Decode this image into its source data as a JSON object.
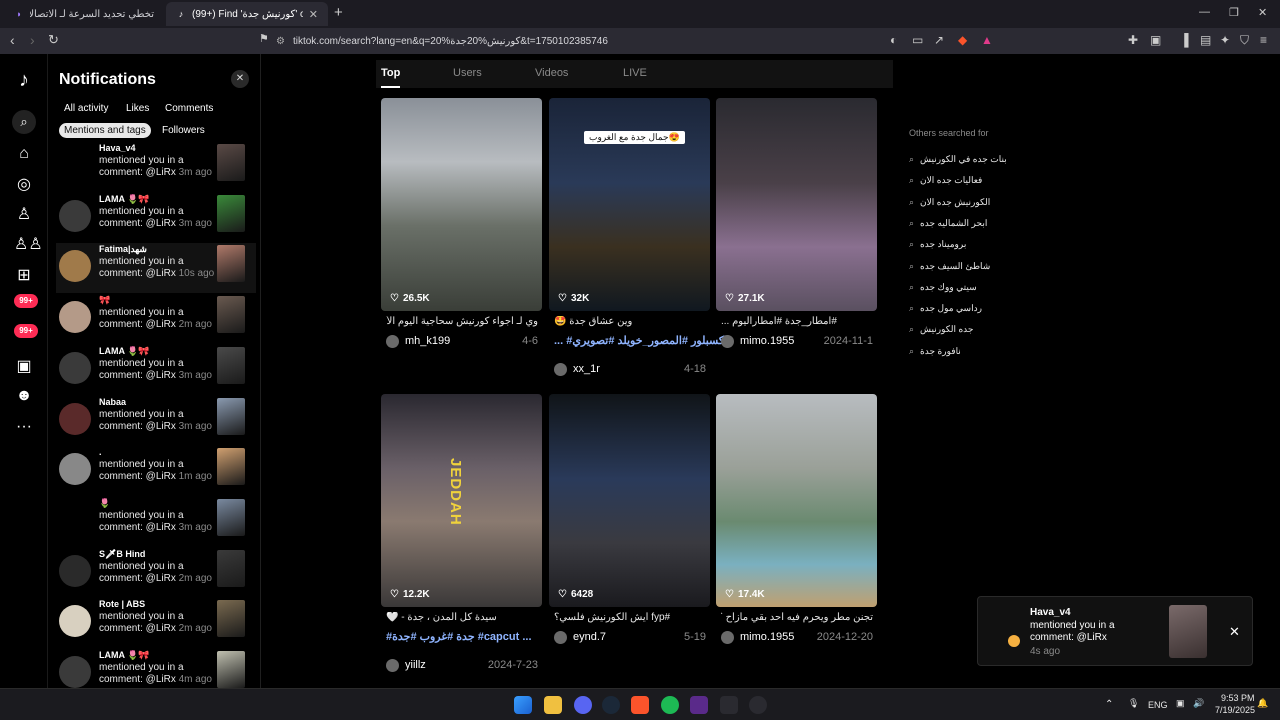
{
  "browser": {
    "tabs": [
      {
        "title": "تخطي تحديد السرعة لـ الاتصالات السعو",
        "active": false
      },
      {
        "title": "(99+) Find 'كورنيش جدة' on TikTok",
        "active": true
      }
    ],
    "new_tab": "+",
    "url": "tiktok.com/search?lang=en&q=كورنيش%20جدة%20&t=1750102385746",
    "window_controls": [
      "—",
      "❐",
      "✕"
    ]
  },
  "rail": {
    "badges": [
      "99+",
      "99+"
    ]
  },
  "notifications": {
    "title": "Notifications",
    "close": "✕",
    "filters": [
      "All activity",
      "Likes",
      "Comments",
      "Mentions and tags",
      "Followers"
    ],
    "active_filter": "Mentions and tags",
    "items": [
      {
        "name": "Hava_v4",
        "line1": "mentioned you in a",
        "line2": "comment: @LiRx",
        "ago": "3m ago",
        "thumb": "#5a4a46",
        "avatar": "none"
      },
      {
        "name": "LAMA 🌷🎀",
        "line1": "mentioned you in a",
        "line2": "comment: @LiRx",
        "ago": "3m ago",
        "thumb": "#3a8a3a",
        "avatar": "#3a3a3a"
      },
      {
        "name": "Fatima|شهد",
        "line1": "mentioned you in a",
        "line2": "comment: @LiRx",
        "ago": "10s ago",
        "thumb": "#b07a6a",
        "avatar": "#a07a4a"
      },
      {
        "name": "🎀",
        "line1": "mentioned you in a",
        "line2": "comment: @LiRx",
        "ago": "2m ago",
        "thumb": "#6a5a50",
        "avatar": "#b49a88"
      },
      {
        "name": "LAMA 🌷🎀",
        "line1": "mentioned you in a",
        "line2": "comment: @LiRx",
        "ago": "3m ago",
        "thumb": "#4a4a4a",
        "avatar": "#3a3a3a"
      },
      {
        "name": "Nabaa",
        "line1": "mentioned you in a",
        "line2": "comment: @LiRx",
        "ago": "3m ago",
        "thumb": "#8a9ab0",
        "avatar": "#5a2a2a"
      },
      {
        "name": ".",
        "line1": "mentioned you in a",
        "line2": "comment: @LiRx",
        "ago": "1m ago",
        "thumb": "#d0a070",
        "avatar": "#888888"
      },
      {
        "name": "🌷",
        "line1": "mentioned you in a",
        "line2": "comment: @LiRx",
        "ago": "3m ago",
        "thumb": "#7a8aa0",
        "avatar": "none"
      },
      {
        "name": "S🗡B Hind",
        "line1": "mentioned you in a",
        "line2": "comment: @LiRx",
        "ago": "2m ago",
        "thumb": "#3a3a3a",
        "avatar": "#2a2a2a"
      },
      {
        "name": "Rote | ABS",
        "line1": "mentioned you in a",
        "line2": "comment: @LiRx",
        "ago": "2m ago",
        "thumb": "#7a6a50",
        "avatar": "#d8d0c0"
      },
      {
        "name": "LAMA 🌷🎀",
        "line1": "mentioned you in a",
        "line2": "comment: @LiRx",
        "ago": "4m ago",
        "thumb": "#c0c0b0",
        "avatar": "#3a3a3a"
      }
    ]
  },
  "search_tabs": [
    "Top",
    "Users",
    "Videos",
    "LIVE"
  ],
  "active_search_tab": "Top",
  "videos": [
    {
      "likes": "26.5K",
      "desc": "وي لـ اجواء كورنيش سحاجية اليوم الأحد...",
      "tags": "",
      "user": "mh_k199",
      "date": "4-6",
      "bg": "linear-gradient(180deg,#8a9098 0%,#b8bcc0 30%,#6a7068 60%,#3a3e38 100%)",
      "label": ""
    },
    {
      "likes": "32K",
      "desc": "وين عشاق جدة 🤩",
      "tags": "... #اكسبلور #المصور_خويلد #تصويري",
      "user": "xx_1r",
      "date": "4-18",
      "bg": "linear-gradient(180deg,#1a2438 0%,#2a3a58 40%,#3a3020 70%,#101820 100%)",
      "label": "جمال جدة مع الغروب😍"
    },
    {
      "likes": "27.1K",
      "desc": "#امطار_جدة #امطاراليوم ...",
      "tags": "",
      "user": "mimo.1955",
      "date": "2024-11-1",
      "bg": "linear-gradient(180deg,#2a2a30 0%,#4a4048 40%,#8a7090 70%,#5a5060 100%)",
      "label": ""
    },
    {
      "likes": "12.2K",
      "desc": "سيدة كل المدن ، جدة - 🤍",
      "tags": "#جدة #غروب #جدة #capcut ...",
      "user": "yiillz",
      "date": "2024-7-23",
      "bg": "linear-gradient(180deg,#2a2830 0%,#6a6068 35%,#8a7a70 60%,#3a3838 100%)",
      "label": "JEDDAH"
    },
    {
      "likes": "6428",
      "desc": "#fyp ايش الكورنيش فلسي؟",
      "tags": "",
      "user": "eynd.7",
      "date": "5-19",
      "bg": "linear-gradient(180deg,#101418 0%,#2a3a5a 40%,#3a3a40 70%,#1a1a1e 100%)",
      "label": ""
    },
    {
      "likes": "17.4K",
      "desc": "تجنن مطر ويحرم فيه احد بقي مازاح ؟",
      "tags": "",
      "user": "mimo.1955",
      "date": "2024-12-20",
      "bg": "linear-gradient(180deg,#b8bcc0 0%,#9aa098 35%,#6a8a70 60%,#7ab0c0 80%,#c0a070 100%)",
      "label": ""
    }
  ],
  "others": {
    "title": "Others searched for",
    "items": [
      "بنات جده في الكورنيش",
      "فعاليات جده الان",
      "الكورنيش جده الان",
      "ابحر الشماليه جده",
      "بروميناد جده",
      "شاطئ السيف جده",
      "سيتي ووك جده",
      "رداسي مول جده",
      "جده الكورنيش",
      "نافورة جدة"
    ]
  },
  "toast": {
    "name": "Hava_v4",
    "line1": "mentioned you in a",
    "line2": "comment: @LiRx",
    "ago": "4s ago",
    "close": "✕"
  },
  "taskbar": {
    "lang": "ENG",
    "time": "9:53 PM",
    "date": "7/19/2025"
  }
}
